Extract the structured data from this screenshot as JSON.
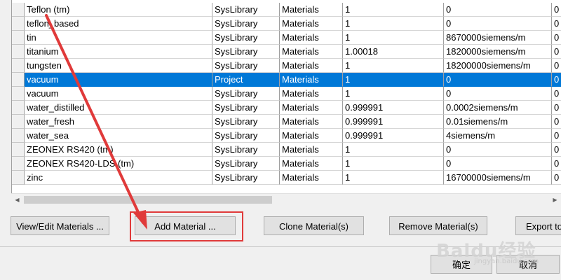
{
  "table": {
    "rows": [
      {
        "name": "Teflon (tm)",
        "library": "SysLibrary",
        "type": "Materials",
        "permittivity": "1",
        "conductivity": "0",
        "extra": "0",
        "selected": false
      },
      {
        "name": "teflon_based",
        "library": "SysLibrary",
        "type": "Materials",
        "permittivity": "1",
        "conductivity": "0",
        "extra": "0",
        "selected": false
      },
      {
        "name": "tin",
        "library": "SysLibrary",
        "type": "Materials",
        "permittivity": "1",
        "conductivity": "8670000siemens/m",
        "extra": "0",
        "selected": false
      },
      {
        "name": "titanium",
        "library": "SysLibrary",
        "type": "Materials",
        "permittivity": "1.00018",
        "conductivity": "1820000siemens/m",
        "extra": "0",
        "selected": false
      },
      {
        "name": "tungsten",
        "library": "SysLibrary",
        "type": "Materials",
        "permittivity": "1",
        "conductivity": "18200000siemens/m",
        "extra": "0",
        "selected": false
      },
      {
        "name": "vacuum",
        "library": "Project",
        "type": "Materials",
        "permittivity": "1",
        "conductivity": "0",
        "extra": "0",
        "selected": true
      },
      {
        "name": "vacuum",
        "library": "SysLibrary",
        "type": "Materials",
        "permittivity": "1",
        "conductivity": "0",
        "extra": "0",
        "selected": false
      },
      {
        "name": "water_distilled",
        "library": "SysLibrary",
        "type": "Materials",
        "permittivity": "0.999991",
        "conductivity": "0.0002siemens/m",
        "extra": "0",
        "selected": false
      },
      {
        "name": "water_fresh",
        "library": "SysLibrary",
        "type": "Materials",
        "permittivity": "0.999991",
        "conductivity": "0.01siemens/m",
        "extra": "0",
        "selected": false
      },
      {
        "name": "water_sea",
        "library": "SysLibrary",
        "type": "Materials",
        "permittivity": "0.999991",
        "conductivity": "4siemens/m",
        "extra": "0",
        "selected": false
      },
      {
        "name": "ZEONEX RS420 (tm)",
        "library": "SysLibrary",
        "type": "Materials",
        "permittivity": "1",
        "conductivity": "0",
        "extra": "0",
        "selected": false
      },
      {
        "name": "ZEONEX RS420-LDS (tm)",
        "library": "SysLibrary",
        "type": "Materials",
        "permittivity": "1",
        "conductivity": "0",
        "extra": "0",
        "selected": false
      },
      {
        "name": "zinc",
        "library": "SysLibrary",
        "type": "Materials",
        "permittivity": "1",
        "conductivity": "16700000siemens/m",
        "extra": "0",
        "selected": false
      }
    ]
  },
  "scrollbar": {
    "left_icon": "scroll-left-arrow-icon",
    "right_icon": "scroll-right-arrow-icon"
  },
  "buttons": {
    "view_edit": "View/Edit Materials ...",
    "add": "Add Material ...",
    "clone": "Clone Material(s)",
    "remove": "Remove Material(s)",
    "export": "Export to",
    "ok": "确定",
    "cancel": "取消"
  },
  "annotation": {
    "color": "#e03a3a"
  },
  "colors": {
    "selection": "#0078d7",
    "background": "#f0f0f0"
  },
  "watermark": {
    "text": "Baidu经验",
    "sub": "jingyan.baidu.com"
  }
}
